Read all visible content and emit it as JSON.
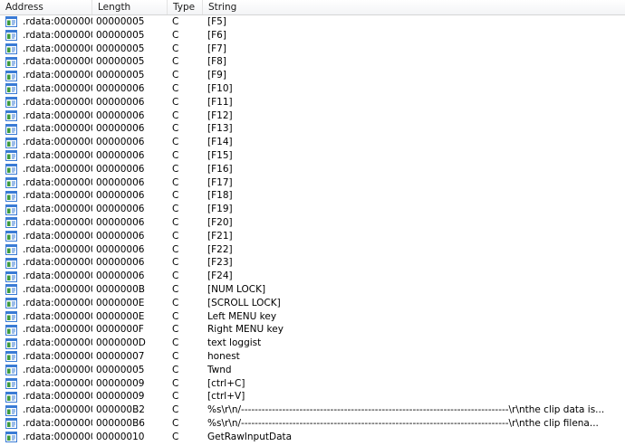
{
  "columns": [
    "Address",
    "Length",
    "Type",
    "String"
  ],
  "rows": [
    {
      "address": ".rdata:0000000...",
      "length": "00000005",
      "type": "C",
      "string": "[F5]"
    },
    {
      "address": ".rdata:0000000...",
      "length": "00000005",
      "type": "C",
      "string": "[F6]"
    },
    {
      "address": ".rdata:0000000...",
      "length": "00000005",
      "type": "C",
      "string": "[F7]"
    },
    {
      "address": ".rdata:0000000...",
      "length": "00000005",
      "type": "C",
      "string": "[F8]"
    },
    {
      "address": ".rdata:0000000...",
      "length": "00000005",
      "type": "C",
      "string": "[F9]"
    },
    {
      "address": ".rdata:0000000...",
      "length": "00000006",
      "type": "C",
      "string": "[F10]"
    },
    {
      "address": ".rdata:0000000...",
      "length": "00000006",
      "type": "C",
      "string": "[F11]"
    },
    {
      "address": ".rdata:0000000...",
      "length": "00000006",
      "type": "C",
      "string": "[F12]"
    },
    {
      "address": ".rdata:0000000...",
      "length": "00000006",
      "type": "C",
      "string": "[F13]"
    },
    {
      "address": ".rdata:0000000...",
      "length": "00000006",
      "type": "C",
      "string": "[F14]"
    },
    {
      "address": ".rdata:0000000...",
      "length": "00000006",
      "type": "C",
      "string": "[F15]"
    },
    {
      "address": ".rdata:0000000...",
      "length": "00000006",
      "type": "C",
      "string": "[F16]"
    },
    {
      "address": ".rdata:0000000...",
      "length": "00000006",
      "type": "C",
      "string": "[F17]"
    },
    {
      "address": ".rdata:0000000...",
      "length": "00000006",
      "type": "C",
      "string": "[F18]"
    },
    {
      "address": ".rdata:0000000...",
      "length": "00000006",
      "type": "C",
      "string": "[F19]"
    },
    {
      "address": ".rdata:0000000...",
      "length": "00000006",
      "type": "C",
      "string": "[F20]"
    },
    {
      "address": ".rdata:0000000...",
      "length": "00000006",
      "type": "C",
      "string": "[F21]"
    },
    {
      "address": ".rdata:0000000...",
      "length": "00000006",
      "type": "C",
      "string": "[F22]"
    },
    {
      "address": ".rdata:0000000...",
      "length": "00000006",
      "type": "C",
      "string": "[F23]"
    },
    {
      "address": ".rdata:0000000...",
      "length": "00000006",
      "type": "C",
      "string": "[F24]"
    },
    {
      "address": ".rdata:0000000...",
      "length": "0000000B",
      "type": "C",
      "string": "[NUM LOCK]"
    },
    {
      "address": ".rdata:0000000...",
      "length": "0000000E",
      "type": "C",
      "string": "[SCROLL LOCK]"
    },
    {
      "address": ".rdata:0000000...",
      "length": "0000000E",
      "type": "C",
      "string": "Left MENU key"
    },
    {
      "address": ".rdata:0000000...",
      "length": "0000000F",
      "type": "C",
      "string": "Right MENU key"
    },
    {
      "address": ".rdata:0000000...",
      "length": "0000000D",
      "type": "C",
      "string": "text loggist"
    },
    {
      "address": ".rdata:0000000...",
      "length": "00000007",
      "type": "C",
      "string": "honest"
    },
    {
      "address": ".rdata:0000000...",
      "length": "00000005",
      "type": "C",
      "string": "Twnd"
    },
    {
      "address": ".rdata:0000000...",
      "length": "00000009",
      "type": "C",
      "string": "[ctrl+C]"
    },
    {
      "address": ".rdata:0000000...",
      "length": "00000009",
      "type": "C",
      "string": "[ctrl+V]"
    },
    {
      "address": ".rdata:0000000...",
      "length": "000000B2",
      "type": "C",
      "string": "%s\\r\\n/------------------------------------------------------------------------------\\r\\nthe clip data is..."
    },
    {
      "address": ".rdata:0000000...",
      "length": "000000B6",
      "type": "C",
      "string": "%s\\r\\n/------------------------------------------------------------------------------\\r\\nthe clip filena..."
    },
    {
      "address": ".rdata:0000000...",
      "length": "00000010",
      "type": "C",
      "string": "GetRawInputData"
    }
  ],
  "icon": "string-entry-icon",
  "colors": {
    "icon_blue": "#3a7bd5",
    "icon_green": "#3c9a3c",
    "header_border": "#d5d5d5"
  }
}
